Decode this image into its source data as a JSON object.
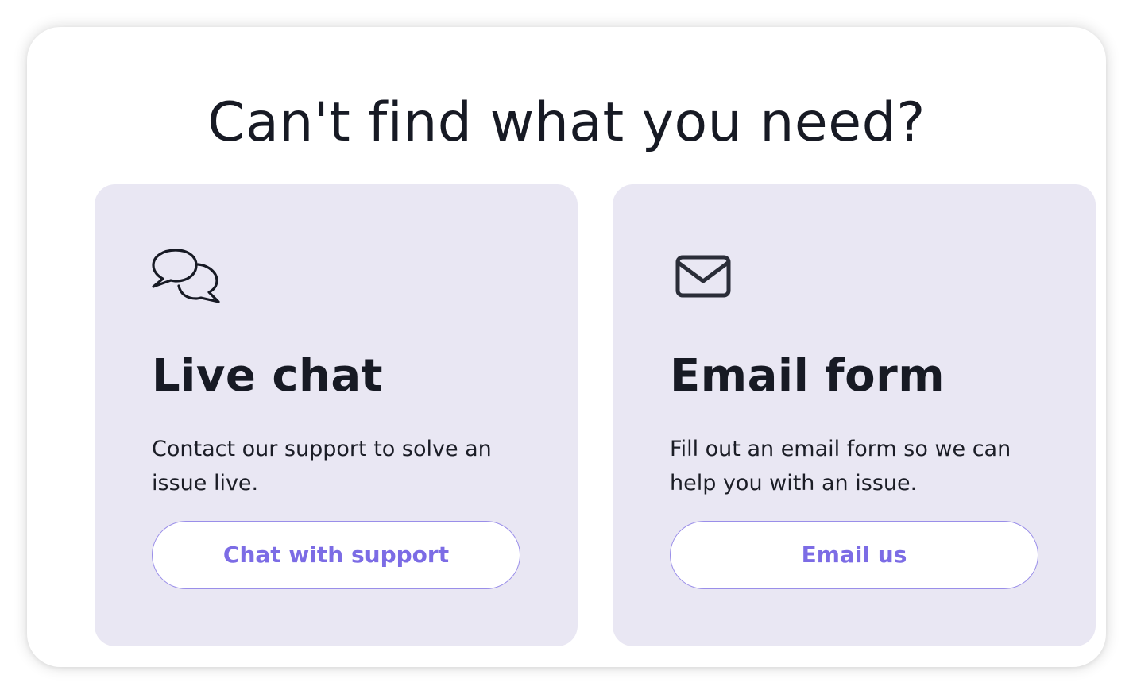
{
  "heading": "Can't find what you need?",
  "cards": [
    {
      "icon": "chat-bubbles-icon",
      "title": "Live chat",
      "description": "Contact our support to solve an issue live.",
      "button_label": "Chat with support"
    },
    {
      "icon": "envelope-icon",
      "title": "Email form",
      "description": "Fill out an email form so we can help you with an issue.",
      "button_label": "Email us"
    }
  ],
  "colors": {
    "card_background": "#e9e7f3",
    "accent": "#7c6ce5",
    "button_border": "#9a8ee9",
    "text": "#171a24"
  }
}
